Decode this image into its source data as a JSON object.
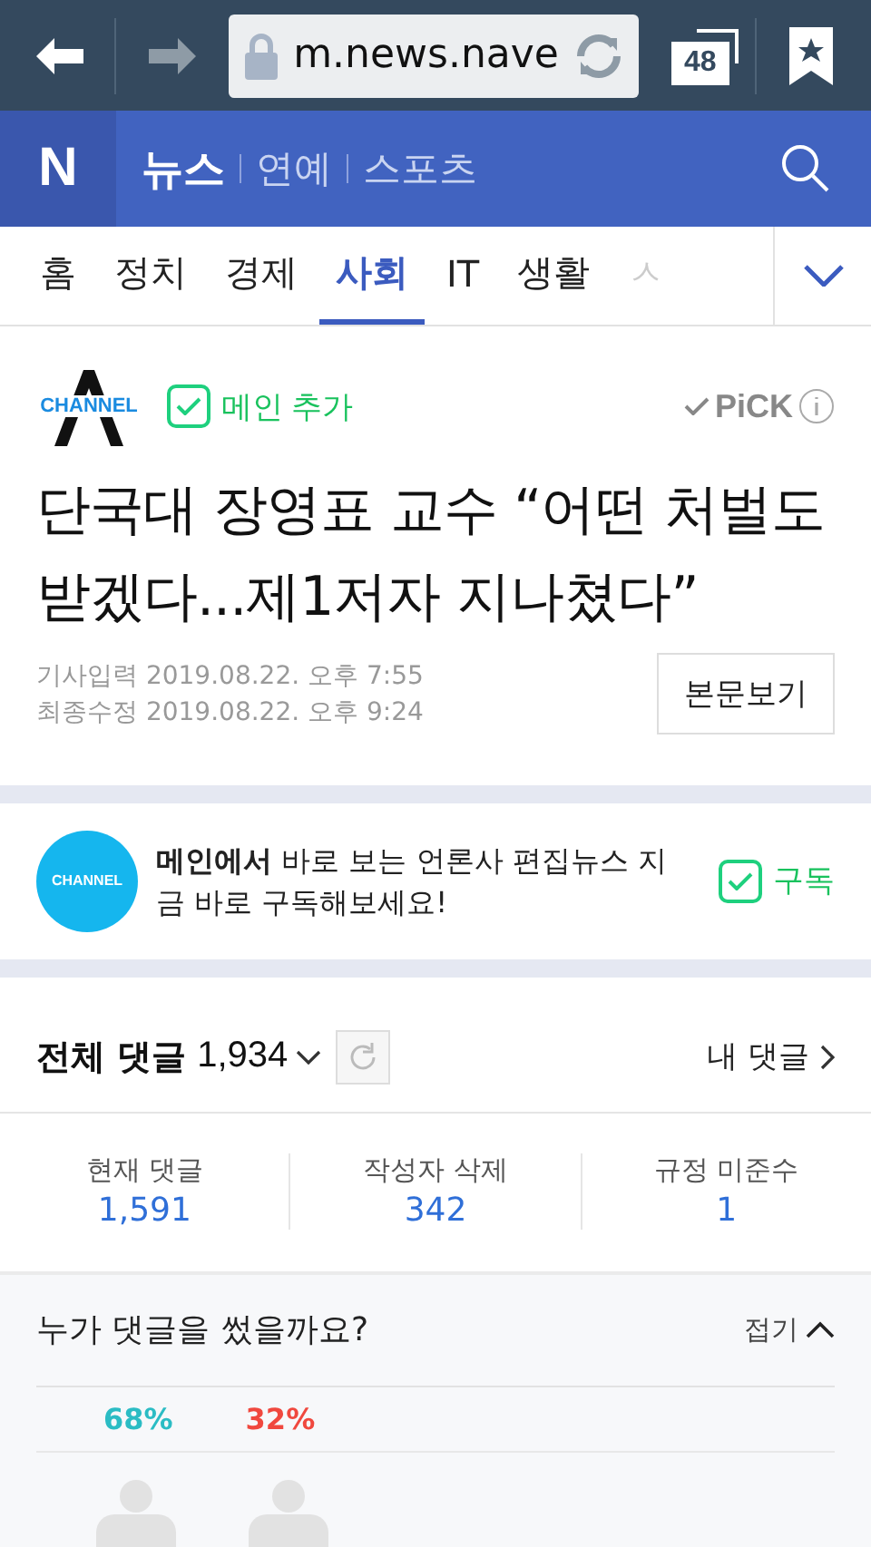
{
  "browser": {
    "logo": "N",
    "url": "m.news.nave",
    "tab_count": "48"
  },
  "header": {
    "sections": [
      {
        "label": "뉴스",
        "selected": true
      },
      {
        "label": "연예",
        "selected": false
      },
      {
        "label": "스포츠",
        "selected": false
      }
    ]
  },
  "tabs": [
    {
      "label": "홈",
      "selected": false
    },
    {
      "label": "정치",
      "selected": false
    },
    {
      "label": "경제",
      "selected": false
    },
    {
      "label": "사회",
      "selected": true
    },
    {
      "label": "IT",
      "selected": false
    },
    {
      "label": "생활",
      "selected": false
    },
    {
      "label": "ㅅ",
      "selected": false
    }
  ],
  "article": {
    "press_logo": "CHANNEL",
    "follow": {
      "label": "메인 추가",
      "checked": true
    },
    "pick": "PiCK",
    "title": "단국대 장영표 교수 “어떤 처벌도 받겠다...제1저자 지나쳤다”",
    "dates": [
      {
        "label": "기사입력",
        "value": "2019.08.22. 오후 7:55"
      },
      {
        "label": "최종수정",
        "value": "2019.08.22. 오후 9:24"
      }
    ],
    "original_button": "본문보기"
  },
  "subscribe": {
    "logo": "CHANNEL",
    "text": "**메인에서** 바로 보는 언론사 편집뉴스 지금 바로 구독해보세요!",
    "button": {
      "label": "구독",
      "checked": true
    }
  },
  "comments": {
    "title": "전체 댓글",
    "count": "1,934",
    "my_comments": "내 댓글",
    "stats": [
      {
        "label": "현재 댓글",
        "value": "1,591"
      },
      {
        "label": "작성자 삭제",
        "value": "342"
      },
      {
        "label": "규정 미준수",
        "value": "1"
      }
    ],
    "who": {
      "title": "누가 댓글을 썼을까요?",
      "toggle": "접기",
      "expanded": true,
      "genders": [
        {
          "value": "68%",
          "color": "#2bbcc4"
        },
        {
          "value": "32%",
          "color": "#f0483e"
        }
      ]
    }
  }
}
